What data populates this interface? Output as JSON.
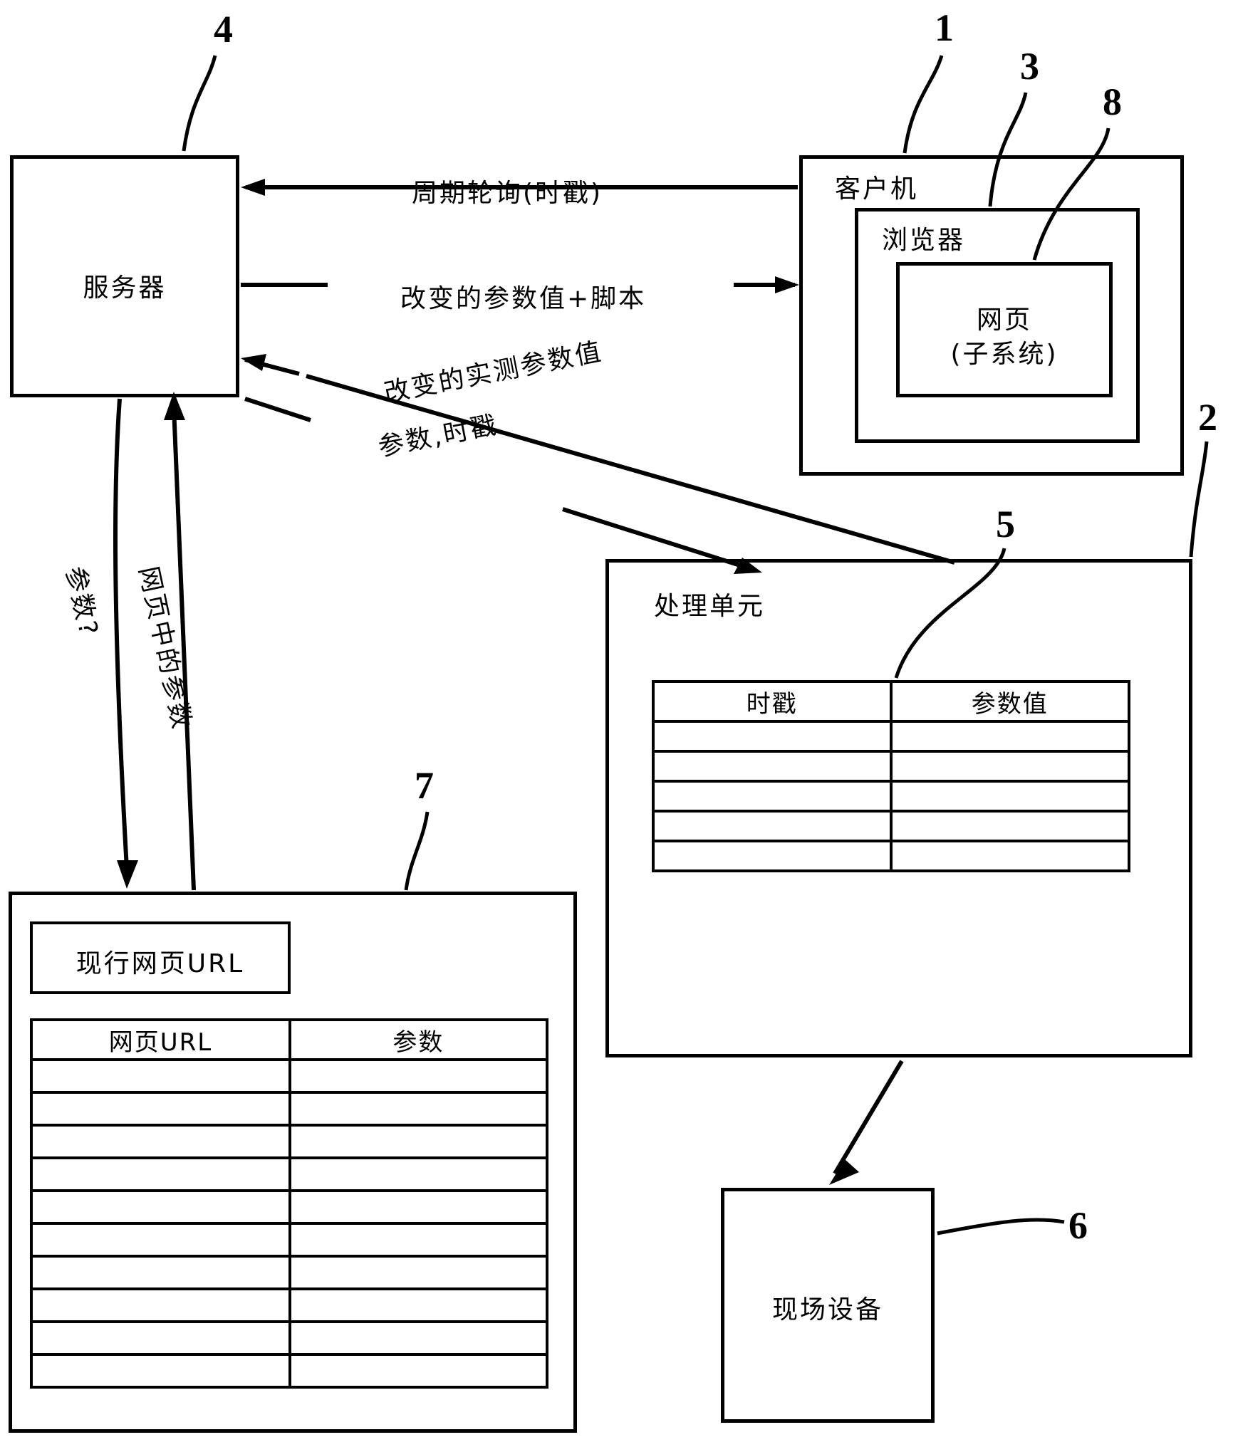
{
  "figure": {
    "type": "patent-diagram",
    "language": "zh-CN"
  },
  "ref_numbers": {
    "client": "1",
    "processing_unit": "2",
    "browser": "3",
    "server": "4",
    "timestamp_table": "5",
    "field_device": "6",
    "url_store": "7",
    "web_page": "8"
  },
  "blocks": {
    "server": {
      "label": "服务器"
    },
    "client": {
      "label": "客户机"
    },
    "browser": {
      "label": "浏览器"
    },
    "web_page": {
      "label_line1": "网页",
      "label_line2": "(子系统)"
    },
    "processing_unit": {
      "label": "处理单元"
    },
    "field_device": {
      "label": "现场设备"
    },
    "url_store": {
      "current_url_label": "现行网页URL",
      "table_headers": [
        "网页URL",
        "参数"
      ],
      "row_count": 10
    },
    "param_table": {
      "headers": [
        "时戳",
        "参数值"
      ],
      "row_count": 5
    }
  },
  "flows": {
    "poll": "周期轮询(时戳)",
    "changed_params_script": "改变的参数值+脚本",
    "changed_measured_values": "改变的实测参数值",
    "params_timestamp": "参数,时戳",
    "param_query": "参数?",
    "params_in_page": "网页中的参数"
  },
  "colors": {
    "ink": "#000000",
    "paper": "#ffffff"
  }
}
